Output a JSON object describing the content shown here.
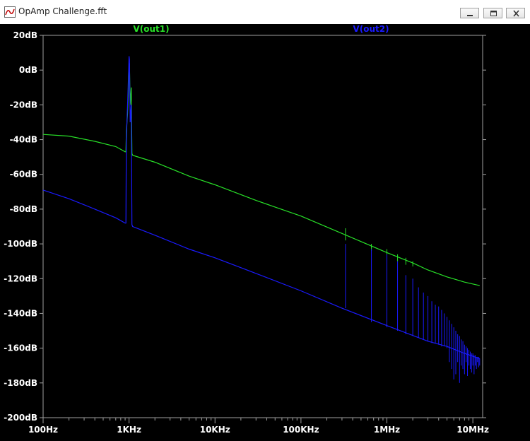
{
  "window": {
    "title": "OpAmp Challenge.fft",
    "buttons": {
      "minimize_icon": "minimize-icon",
      "maximize_icon": "maximize-icon",
      "close_icon": "close-icon"
    }
  },
  "colors": {
    "background": "#000000",
    "axis": "#a0a0a0",
    "tick_text": "#ffffff",
    "out1": "#28e028",
    "out2": "#1a1aff"
  },
  "chart_data": {
    "type": "line",
    "xscale": "log",
    "xlim": [
      100,
      13000000
    ],
    "ylim": [
      -200,
      20
    ],
    "xticks": [
      100,
      1000,
      10000,
      100000,
      1000000,
      10000000
    ],
    "xtick_labels": [
      "100Hz",
      "1KHz",
      "10KHz",
      "100KHz",
      "1MHz",
      "10MHz"
    ],
    "yticks": [
      20,
      0,
      -20,
      -40,
      -60,
      -80,
      -100,
      -120,
      -140,
      -160,
      -180,
      -200
    ],
    "ytick_labels": [
      "20dB",
      "0dB",
      "-20dB",
      "-40dB",
      "-60dB",
      "-80dB",
      "-100dB",
      "-120dB",
      "-140dB",
      "-160dB",
      "-180dB",
      "-200dB"
    ],
    "series": [
      {
        "name": "V(out1)",
        "color": "#28e028",
        "points": [
          [
            100,
            -37
          ],
          [
            200,
            -38
          ],
          [
            400,
            -41
          ],
          [
            700,
            -44
          ],
          [
            900,
            -47
          ],
          [
            920,
            -47
          ],
          [
            930,
            -35
          ],
          [
            960,
            -25
          ],
          [
            990,
            -7
          ],
          [
            1000,
            2
          ],
          [
            1010,
            4
          ],
          [
            1030,
            -20
          ],
          [
            1060,
            -10
          ],
          [
            1080,
            -48
          ],
          [
            1100,
            -49
          ],
          [
            2000,
            -53
          ],
          [
            5000,
            -61
          ],
          [
            10000,
            -66
          ],
          [
            30000,
            -75
          ],
          [
            100000,
            -84
          ],
          [
            300000,
            -94
          ],
          [
            1000000,
            -105
          ],
          [
            2000000,
            -111
          ],
          [
            3000000,
            -115
          ],
          [
            5000000,
            -119
          ],
          [
            8000000,
            -122
          ],
          [
            12000000,
            -124
          ]
        ],
        "spikes": [
          [
            330000,
            -91,
            -98
          ],
          [
            660000,
            -100,
            -104
          ],
          [
            1000000,
            -103,
            -106
          ],
          [
            1330000,
            -106,
            -110
          ],
          [
            1660000,
            -108,
            -112
          ],
          [
            2000000,
            -110,
            -113
          ]
        ]
      },
      {
        "name": "V(out2)",
        "color": "#1a1aff",
        "points": [
          [
            100,
            -69
          ],
          [
            200,
            -74
          ],
          [
            400,
            -80
          ],
          [
            700,
            -85
          ],
          [
            900,
            -88
          ],
          [
            920,
            -88
          ],
          [
            930,
            -40
          ],
          [
            960,
            -20
          ],
          [
            990,
            0
          ],
          [
            1000,
            8
          ],
          [
            1010,
            6
          ],
          [
            1030,
            -30
          ],
          [
            1060,
            -20
          ],
          [
            1080,
            -89
          ],
          [
            1100,
            -90
          ],
          [
            2000,
            -95
          ],
          [
            5000,
            -103
          ],
          [
            10000,
            -108
          ],
          [
            30000,
            -117
          ],
          [
            100000,
            -127
          ],
          [
            300000,
            -137
          ],
          [
            1000000,
            -147
          ],
          [
            3000000,
            -156
          ],
          [
            5000000,
            -159
          ],
          [
            8000000,
            -163
          ],
          [
            12000000,
            -166
          ]
        ],
        "spikes": [
          [
            330000,
            -100,
            -137
          ],
          [
            660000,
            -103,
            -145
          ],
          [
            1000000,
            -106,
            -148
          ],
          [
            1330000,
            -110,
            -150
          ],
          [
            1660000,
            -118,
            -152
          ],
          [
            2000000,
            -120,
            -153
          ],
          [
            2330000,
            -125,
            -154
          ],
          [
            2660000,
            -128,
            -155
          ],
          [
            3000000,
            -130,
            -156
          ],
          [
            3330000,
            -133,
            -157
          ],
          [
            3660000,
            -135,
            -157
          ],
          [
            4000000,
            -136,
            -158
          ],
          [
            4330000,
            -138,
            -159
          ],
          [
            4660000,
            -140,
            -159
          ],
          [
            5000000,
            -142,
            -160
          ],
          [
            5330000,
            -144,
            -168
          ],
          [
            5660000,
            -146,
            -172
          ],
          [
            6000000,
            -148,
            -178
          ],
          [
            6330000,
            -150,
            -175
          ],
          [
            6660000,
            -152,
            -168
          ],
          [
            7000000,
            -153,
            -180
          ],
          [
            7330000,
            -155,
            -170
          ],
          [
            7660000,
            -156,
            -172
          ],
          [
            8000000,
            -158,
            -175
          ],
          [
            8330000,
            -159,
            -168
          ],
          [
            8660000,
            -160,
            -176
          ],
          [
            9000000,
            -161,
            -170
          ],
          [
            9330000,
            -162,
            -172
          ],
          [
            9660000,
            -163,
            -174
          ],
          [
            10000000,
            -163,
            -170
          ],
          [
            10330000,
            -164,
            -175
          ],
          [
            10660000,
            -164,
            -170
          ],
          [
            11000000,
            -165,
            -172
          ],
          [
            11330000,
            -165,
            -168
          ],
          [
            11660000,
            -165,
            -171
          ],
          [
            12000000,
            -166,
            -170
          ]
        ]
      }
    ]
  }
}
